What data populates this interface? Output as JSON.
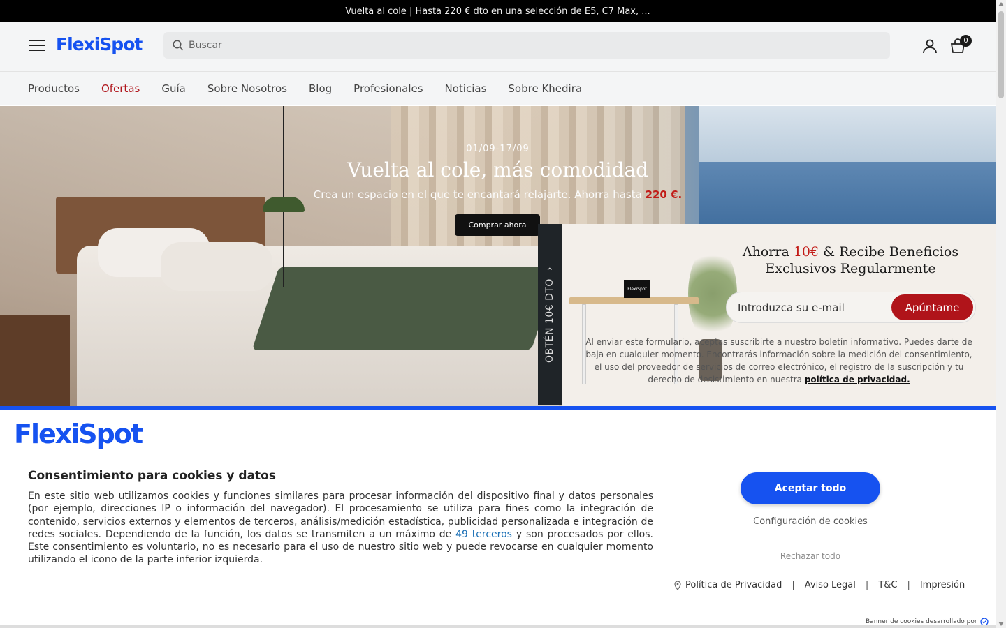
{
  "announcement": {
    "text": "Vuelta al cole | Hasta 220 € dto en una selección de E5, C7 Max, ..."
  },
  "header": {
    "logo": "FlexiSpot",
    "search_placeholder": "Buscar",
    "cart_count": "0"
  },
  "nav": {
    "items": [
      {
        "label": "Productos"
      },
      {
        "label": "Ofertas"
      },
      {
        "label": "Guía"
      },
      {
        "label": "Sobre Nosotros"
      },
      {
        "label": "Blog"
      },
      {
        "label": "Profesionales"
      },
      {
        "label": "Noticias"
      },
      {
        "label": "Sobre Khedira"
      }
    ],
    "highlight_color": "#b0141a"
  },
  "hero": {
    "date": "01/09-17/09",
    "title": "Vuelta al cole, más comodidad",
    "subtitle": "Crea un espacio en el que te encantará relajarte. Ahorra hasta",
    "subtitle_highlight": "220 €.",
    "button": "Comprar ahora"
  },
  "newsletter": {
    "tab_label": "OBTÉN 10€ DTO",
    "tab_chevron": "›",
    "monitor_logo": "FlexiSpot",
    "title_prefix": "Ahorra",
    "title_amount": "10€",
    "title_suffix": "& Recibe Beneficios Exclusivos Regularmente",
    "email_placeholder": "Introduzca su e-mail",
    "button": "Apúntame",
    "legal_text": "Al enviar este formulario, aceptas suscribirte a nuestro boletín informativo. Puedes darte de baja en cualquier momento. Encontrarás información sobre la medición del consentimiento, el uso del proveedor de servicios de correo electrónico, el registro de la suscripción y tu derecho de desistimiento en nuestra",
    "legal_link": "política de privacidad."
  },
  "cookie_banner": {
    "logo": "FlexiSpot",
    "title": "Consentimiento para cookies y datos",
    "text_before_link": "En este sitio web utilizamos cookies y funciones similares para procesar información del dispositivo final y datos personales (por ejemplo, direcciones IP o información del navegador). El procesamiento se utiliza para fines como la integración de contenido, servicios externos y elementos de terceros, análisis/medición estadística, publicidad personalizada e integración de redes sociales. Dependiendo de la función, los datos se transmiten a un máximo de",
    "link_text": "49 terceros",
    "text_after_link": "y son procesados por ellos. Este consentimiento es voluntario, no es necesario para el uso de nuestro sitio web y puede revocarse en cualquier momento utilizando el icono de la parte inferior izquierda.",
    "accept_button": "Aceptar todo",
    "settings_link": "Configuración de cookies",
    "reject_link": "Rechazar todo",
    "footer_links": [
      "Política de Privacidad",
      "Aviso Legal",
      "T&C",
      "Impresión"
    ],
    "separator": "|",
    "powered_by": "Banner de cookies desarrollado por",
    "accent_color": "#1652f0"
  }
}
